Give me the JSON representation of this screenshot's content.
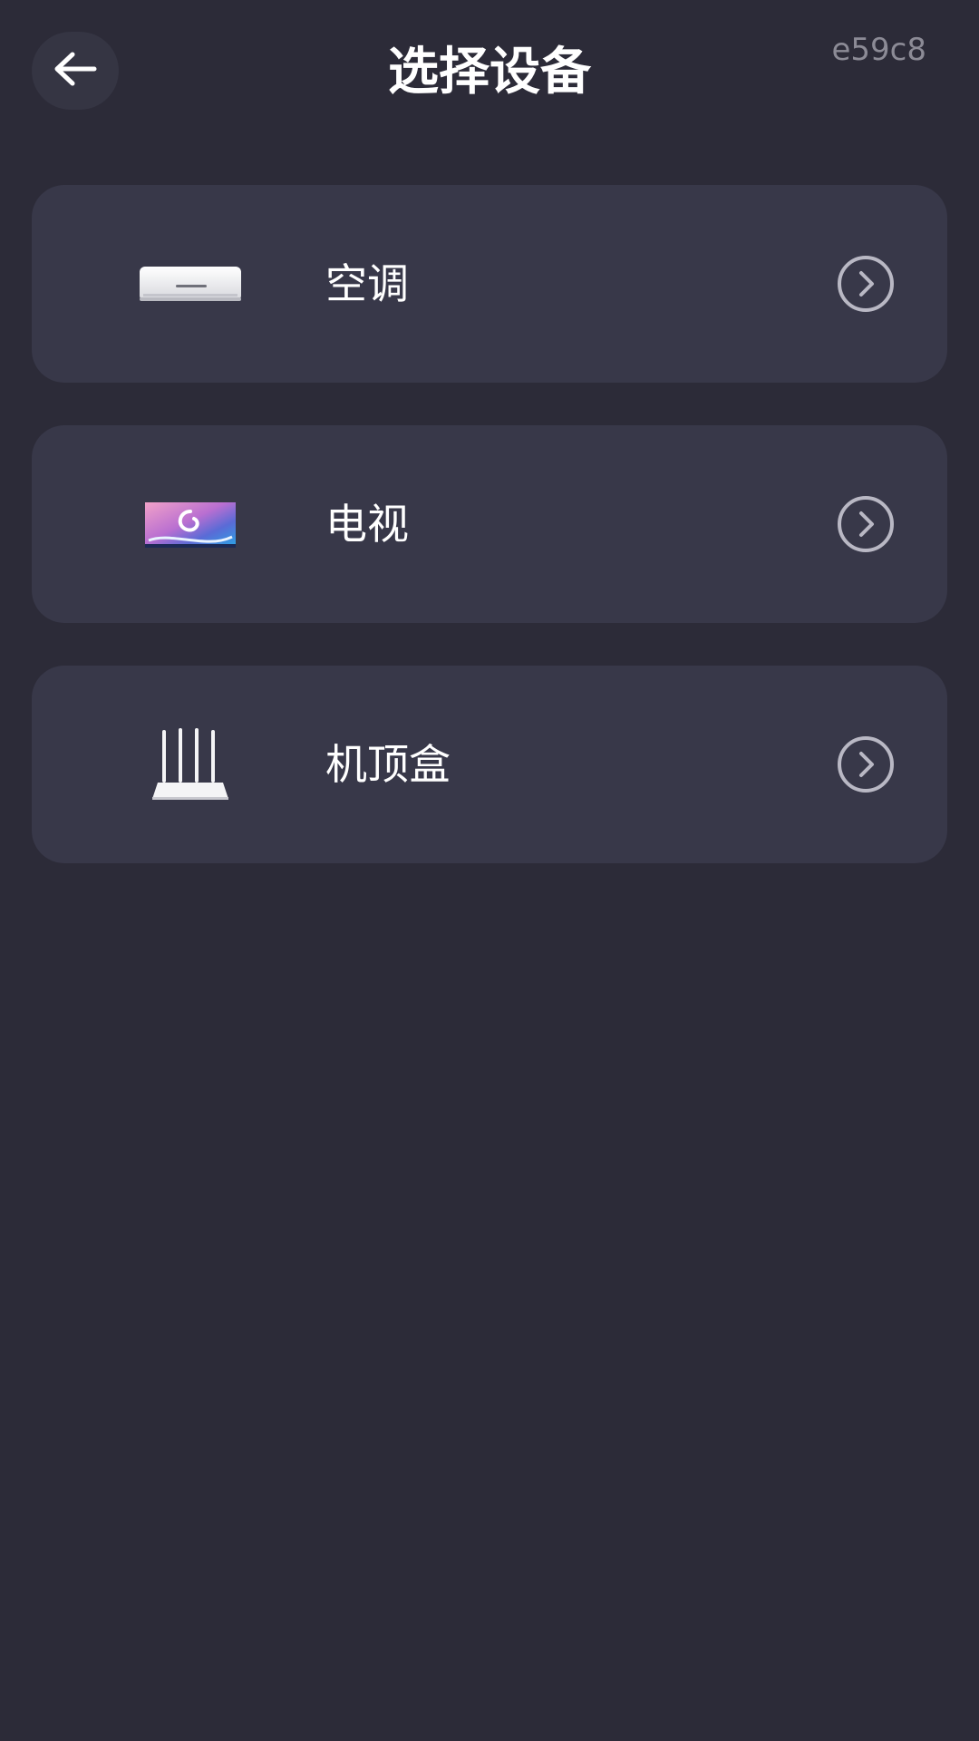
{
  "header": {
    "title": "选择设备",
    "code": "e59c8",
    "back_icon": "arrow-left-icon"
  },
  "devices": [
    {
      "label": "空调",
      "icon": "air-conditioner-icon"
    },
    {
      "label": "电视",
      "icon": "television-icon"
    },
    {
      "label": "机顶盒",
      "icon": "set-top-box-icon"
    }
  ],
  "colors": {
    "background": "#2c2b38",
    "card": "#383849",
    "text": "#ffffff",
    "muted": "#8c8b96"
  }
}
